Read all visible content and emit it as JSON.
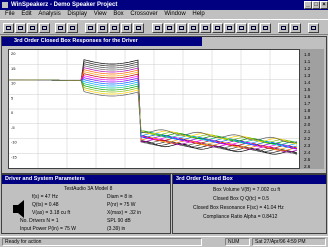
{
  "window": {
    "title": "WinSpeakerz - Demo Speaker Project"
  },
  "menu": [
    "File",
    "Edit",
    "Analysis",
    "Display",
    "View",
    "Box",
    "Crossover",
    "Window",
    "Help"
  ],
  "graph": {
    "title": "3rd Order Closed Box Responses for the Driver",
    "freq_labels": [
      "1.0",
      "1.1",
      "1.2",
      "1.3",
      "1.4",
      "1.5",
      "1.6",
      "1.7",
      "1.8",
      "1.9",
      "2.0",
      "2.1",
      "2.2",
      "2.3",
      "2.4",
      "2.5",
      "2.6"
    ],
    "db_labels": [
      "20",
      "15",
      "10",
      "5",
      "0",
      "-5",
      "-10",
      "-15"
    ]
  },
  "driver_panel": {
    "title": "Driver and System Parameters",
    "name": "TestAudio 3A Model 8",
    "rows": [
      [
        "f(s) = 47   Hz",
        "Diam = 8   in"
      ],
      [
        "Q(ts) = 0.48",
        "P(nr) = 75   W"
      ],
      [
        "V(as) = 3.18   cu ft",
        "X(max) = .32   in"
      ],
      [
        "No. Drivers   N = 1",
        "SPL 90   dB"
      ],
      [
        "Input Power  P(in) = 75   W",
        "(3.39)   in"
      ]
    ]
  },
  "box_panel": {
    "title": "3rd Order Closed Box",
    "rows": [
      "Box Volume   V(B) = 7.002  cu ft",
      "Closed Box Q    Q(tc) = 0.5",
      "Closed Box Resonance   F(sc) = 41.04   Hz",
      "Compliance Ratio   Alpha = 0.8412"
    ]
  },
  "status": {
    "left": "Ready for action",
    "mid": "NUM",
    "right": "Sat 27/Apr/96  4:59 PM"
  }
}
